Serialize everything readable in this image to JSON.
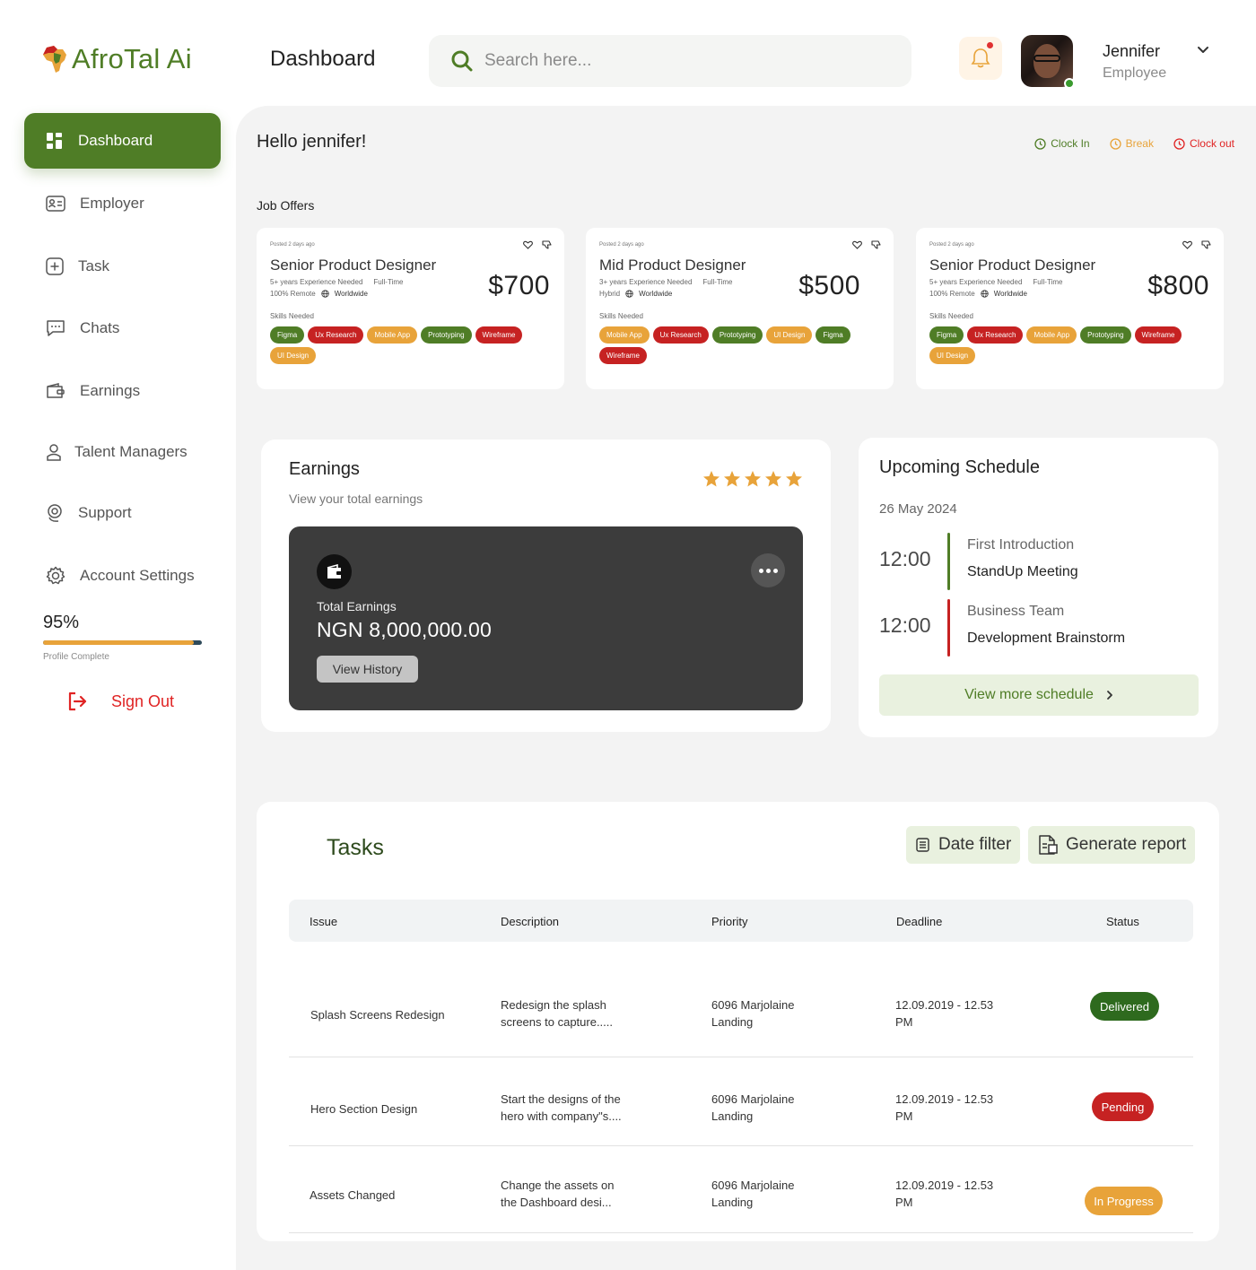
{
  "app": {
    "logo_text": "AfroTal",
    "logo_suffix": "Ai",
    "page_title": "Dashboard"
  },
  "search": {
    "placeholder": "Search here..."
  },
  "user": {
    "name": "Jennifer",
    "role": "Employee"
  },
  "sidebar": {
    "items": [
      {
        "label": "Dashboard",
        "icon": "grid-icon"
      },
      {
        "label": "Employer",
        "icon": "id-card-icon"
      },
      {
        "label": "Task",
        "icon": "plus-square-icon"
      },
      {
        "label": "Chats",
        "icon": "chat-icon"
      },
      {
        "label": "Earnings",
        "icon": "wallet-icon"
      },
      {
        "label": "Talent Managers",
        "icon": "user-icon"
      },
      {
        "label": "Support",
        "icon": "headset-icon"
      },
      {
        "label": "Account Settings",
        "icon": "gear-icon"
      }
    ],
    "profile": {
      "percent_label": "95%",
      "percent": 0.95,
      "label": "Profile Complete"
    },
    "sign_out": "Sign Out"
  },
  "greeting": "Hello jennifer!",
  "clock": {
    "in": "Clock In",
    "break": "Break",
    "out": "Clock out"
  },
  "job_offers": {
    "label": "Job Offers",
    "cards": [
      {
        "posted": "Posted 2 days ago",
        "title": "Senior Product Designer",
        "experience": "5+ years Experience Needed",
        "type": "Full-Time",
        "mode": "100% Remote",
        "location": "Worldwide",
        "price": "$700",
        "skills_label": "Skills Needed",
        "tags": [
          {
            "label": "Figma",
            "color": "green"
          },
          {
            "label": "Ux Research",
            "color": "red"
          },
          {
            "label": "Mobile App",
            "color": "orange"
          },
          {
            "label": "Prototyping",
            "color": "green"
          },
          {
            "label": "Wireframe",
            "color": "red"
          },
          {
            "label": "UI Design",
            "color": "orange"
          }
        ]
      },
      {
        "posted": "Posted 2 days ago",
        "title": "Mid Product Designer",
        "experience": "3+ years Experience Needed",
        "type": "Full-Time",
        "mode": "Hybrid",
        "location": "Worldwide",
        "price": "$500",
        "skills_label": "Skills Needed",
        "tags": [
          {
            "label": "Mobile App",
            "color": "orange"
          },
          {
            "label": "Ux Research",
            "color": "red"
          },
          {
            "label": "Prototyping",
            "color": "green"
          },
          {
            "label": "UI Design",
            "color": "orange"
          },
          {
            "label": "Figma",
            "color": "green"
          },
          {
            "label": "Wireframe",
            "color": "red"
          }
        ]
      },
      {
        "posted": "Posted 2 days ago",
        "title": "Senior Product Designer",
        "experience": "5+ years Experience Needed",
        "type": "Full-Time",
        "mode": "100% Remote",
        "location": "Worldwide",
        "price": "$800",
        "skills_label": "Skills Needed",
        "tags": [
          {
            "label": "Figma",
            "color": "green"
          },
          {
            "label": "Ux Research",
            "color": "red"
          },
          {
            "label": "Mobile App",
            "color": "orange"
          },
          {
            "label": "Prototyping",
            "color": "green"
          },
          {
            "label": "Wireframe",
            "color": "red"
          },
          {
            "label": "UI Design",
            "color": "orange"
          }
        ]
      }
    ]
  },
  "earnings": {
    "title": "Earnings",
    "subtitle": "View your total earnings",
    "rating": 5,
    "total_label": "Total Earnings",
    "total_value": "NGN 8,000,000.00",
    "history_button": "View History"
  },
  "schedule": {
    "title": "Upcoming Schedule",
    "date": "26 May 2024",
    "items": [
      {
        "time": "12:00",
        "line1": "First Introduction",
        "line2": "StandUp Meeting",
        "color": "#4f7d26"
      },
      {
        "time": "12:00",
        "line1": "Business Team",
        "line2": "Development Brainstorm",
        "color": "#c62222"
      }
    ],
    "more_button": "View more schedule"
  },
  "tasks": {
    "title": "Tasks",
    "date_filter": "Date filter",
    "generate_report": "Generate report",
    "columns": [
      "Issue",
      "Description",
      "Priority",
      "Deadline",
      "Status"
    ],
    "rows": [
      {
        "issue": "Splash Screens Redesign",
        "description": [
          "Redesign the splash",
          "screens to capture....."
        ],
        "priority": [
          "6096 Marjolaine",
          "Landing"
        ],
        "deadline": [
          "12.09.2019 - 12.53",
          "PM"
        ],
        "status": "Delivered"
      },
      {
        "issue": "Hero Section Design",
        "description": [
          "Start the designs of the",
          "hero with company\"s...."
        ],
        "priority": [
          "6096 Marjolaine",
          "Landing"
        ],
        "deadline": [
          "12.09.2019 - 12.53",
          "PM"
        ],
        "status": "Pending"
      },
      {
        "issue": "Assets Changed",
        "description": [
          "Change the assets on",
          "the Dashboard desi..."
        ],
        "priority": [
          "6096 Marjolaine",
          "Landing"
        ],
        "deadline": [
          "12.09.2019 - 12.53",
          "PM"
        ],
        "status": "In Progress"
      }
    ]
  },
  "colors": {
    "brand_green": "#4f7d26",
    "accent_orange": "#e8a33a",
    "danger_red": "#c62222"
  }
}
